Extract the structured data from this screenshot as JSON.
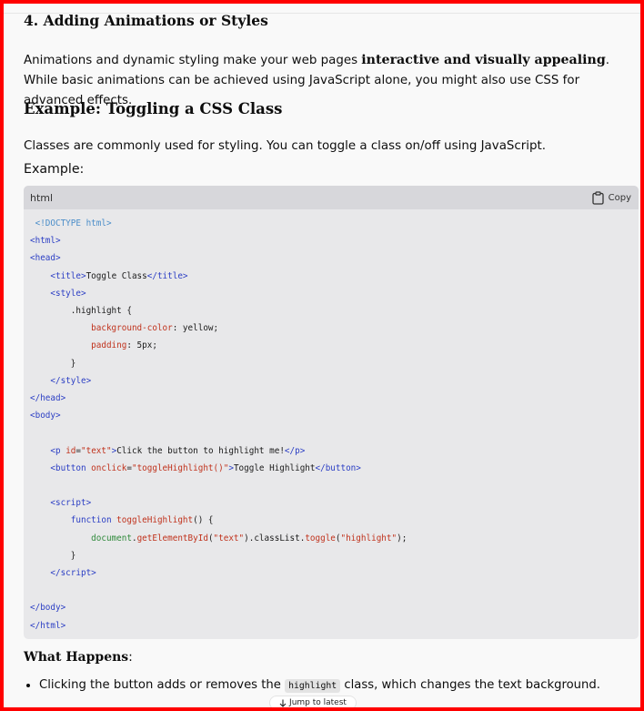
{
  "section": {
    "heading": "4. Adding Animations or Styles"
  },
  "intro": {
    "part1": "Animations and dynamic styling make your web pages ",
    "strong": "interactive and visually appealing",
    "part2": ". While basic animations can be achieved using JavaScript alone, you might also use CSS for advanced effects."
  },
  "example_heading": "Example: Toggling a CSS Class",
  "classes_text": "Classes are commonly used for styling. You can toggle a class on/off using JavaScript.",
  "example_label": "Example:",
  "code_block": {
    "language": "html",
    "copy_label": "Copy",
    "icon": "clipboard-icon"
  },
  "what_happens": {
    "label": "What Happens",
    "colon": ":"
  },
  "bullet": {
    "before": "Clicking the button adds or removes the ",
    "code": "highlight",
    "after": " class, which changes the text background."
  },
  "jump": {
    "label": "Jump to latest",
    "icon": "arrow-down-icon"
  },
  "colors": {
    "frame": "#ff0000",
    "background": "#f9f9f9",
    "code_bg": "#e8e8ea",
    "code_header": "#d7d7db"
  }
}
